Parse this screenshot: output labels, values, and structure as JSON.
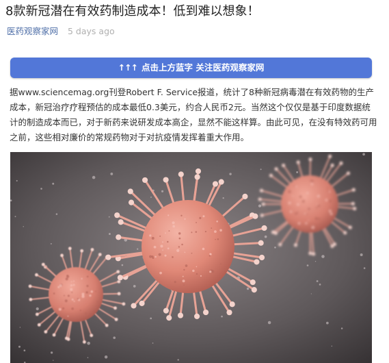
{
  "article": {
    "title": "8款新冠潜在有效药制造成本！低到难以想象！",
    "author": "医药观察家网",
    "time": "5 days ago",
    "follow_button": {
      "arrows": "↑↑↑",
      "label": "点击上方蓝字  关注医药观察家网"
    },
    "body": "据www.sciencemag.org刊登Robert F. Service报道，统计了8种新冠病毒潜在有效药物的生产成本，新冠治疗疗程预估的成本最低0.3美元，约合人民币2元。当然这个仅仅是基于印度数据统计的制造成本而已，对于新药来说研发成本高企，显然不能这样算。由此可见，在没有特效药可用之前，这些相对廉价的常规药物对于对抗疫情发挥着重大作用。",
    "image": {
      "subject": "coronavirus-illustration",
      "colors": {
        "background": "#5a5557",
        "virus": "#e8907f",
        "spike_tip": "#f4d3cc"
      }
    }
  }
}
